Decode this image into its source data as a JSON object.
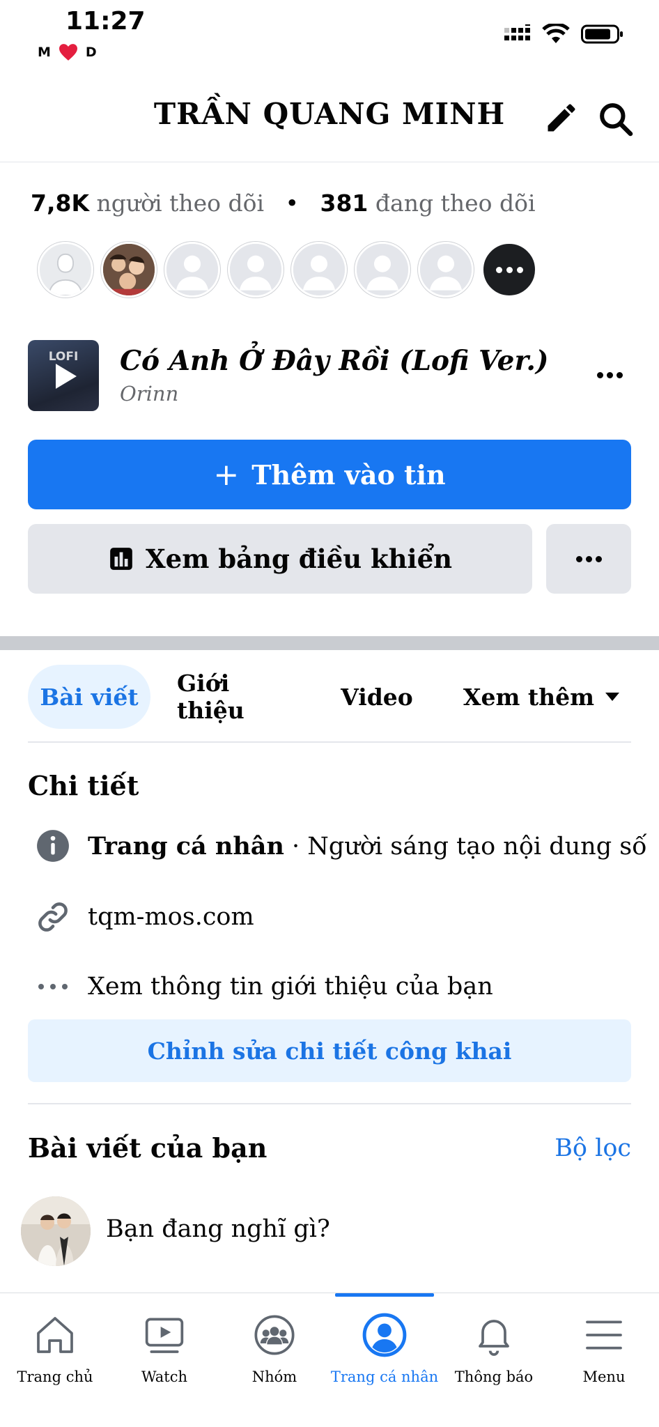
{
  "status_bar": {
    "time": "11:27",
    "left_initial": "M",
    "right_initial": "D"
  },
  "header": {
    "title": "TRẦN QUANG MINH"
  },
  "profile": {
    "followers_count": "7,8K",
    "followers_label": "người theo dõi",
    "separator": "•",
    "following_count": "381",
    "following_label": "đang theo dõi"
  },
  "music": {
    "thumb_label": "LOFI",
    "title": "Có Anh Ở Đây Rồi (Lofi Ver.)",
    "artist": "Orinn"
  },
  "actions": {
    "add_story_icon": "+",
    "add_story_label": "Thêm vào tin",
    "dashboard_label": "Xem bảng điều khiển"
  },
  "tabs": {
    "posts": "Bài viết",
    "about": "Giới thiệu",
    "video": "Video",
    "more": "Xem thêm"
  },
  "details": {
    "title": "Chi tiết",
    "profile_type_bold": "Trang cá nhân",
    "profile_type_rest": " · Người sáng tạo nội dung số",
    "website": "tqm-mos.com",
    "see_about": "Xem thông tin giới thiệu của bạn",
    "edit_button": "Chỉnh sửa chi tiết công khai"
  },
  "posts": {
    "title": "Bài viết của bạn",
    "filter": "Bộ lọc",
    "composer_placeholder": "Bạn đang nghĩ gì?"
  },
  "bottom_nav": [
    {
      "label": "Trang chủ",
      "icon": "home-icon"
    },
    {
      "label": "Watch",
      "icon": "watch-icon"
    },
    {
      "label": "Nhóm",
      "icon": "groups-icon"
    },
    {
      "label": "Trang cá nhân",
      "icon": "profile-icon"
    },
    {
      "label": "Thông báo",
      "icon": "bell-icon"
    },
    {
      "label": "Menu",
      "icon": "menu-icon"
    }
  ],
  "colors": {
    "accent": "#1877f2",
    "accent_text": "#1b74e4",
    "light_blue": "#e7f3ff",
    "gray_button": "#e4e6eb",
    "secondary_text": "#65676b"
  }
}
